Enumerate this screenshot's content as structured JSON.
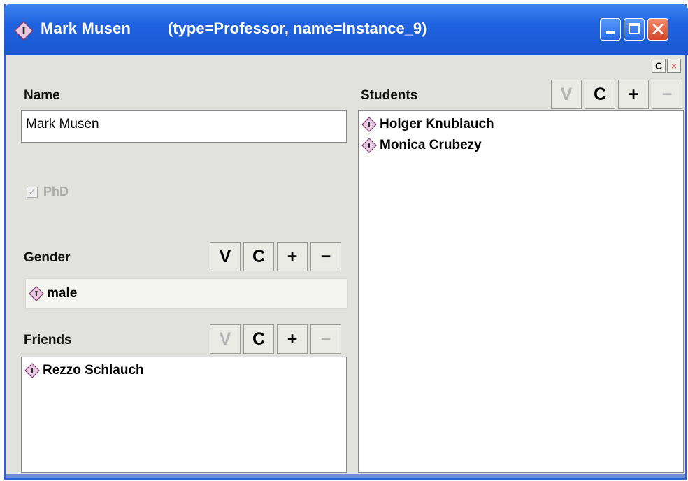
{
  "window": {
    "title_name": "Mark Musen",
    "title_desc": "(type=Professor, name=Instance_9)",
    "close_glyph": "✕"
  },
  "toolbar": {
    "c_label": "C",
    "x_label": "×"
  },
  "name_slot": {
    "label": "Name",
    "value": "Mark Musen"
  },
  "phd_slot": {
    "label": "PhD",
    "checked": true,
    "check_glyph": "✓"
  },
  "gender_slot": {
    "label": "Gender",
    "buttons": {
      "v": "V",
      "c": "C",
      "add": "+",
      "remove": "−"
    },
    "value": "male"
  },
  "friends_slot": {
    "label": "Friends",
    "buttons": {
      "v": "V",
      "c": "C",
      "add": "+",
      "remove": "−"
    },
    "items": [
      "Rezzo Schlauch"
    ]
  },
  "students_slot": {
    "label": "Students",
    "buttons": {
      "v": "V",
      "c": "C",
      "add": "+",
      "remove": "−"
    },
    "items": [
      "Holger Knublauch",
      "Monica Crubezy"
    ]
  },
  "icons": {
    "instance": "instance-diamond-icon"
  },
  "colors": {
    "titlebar": "#1f62e0",
    "panel": "#e1e1dd",
    "close": "#d6452a"
  }
}
